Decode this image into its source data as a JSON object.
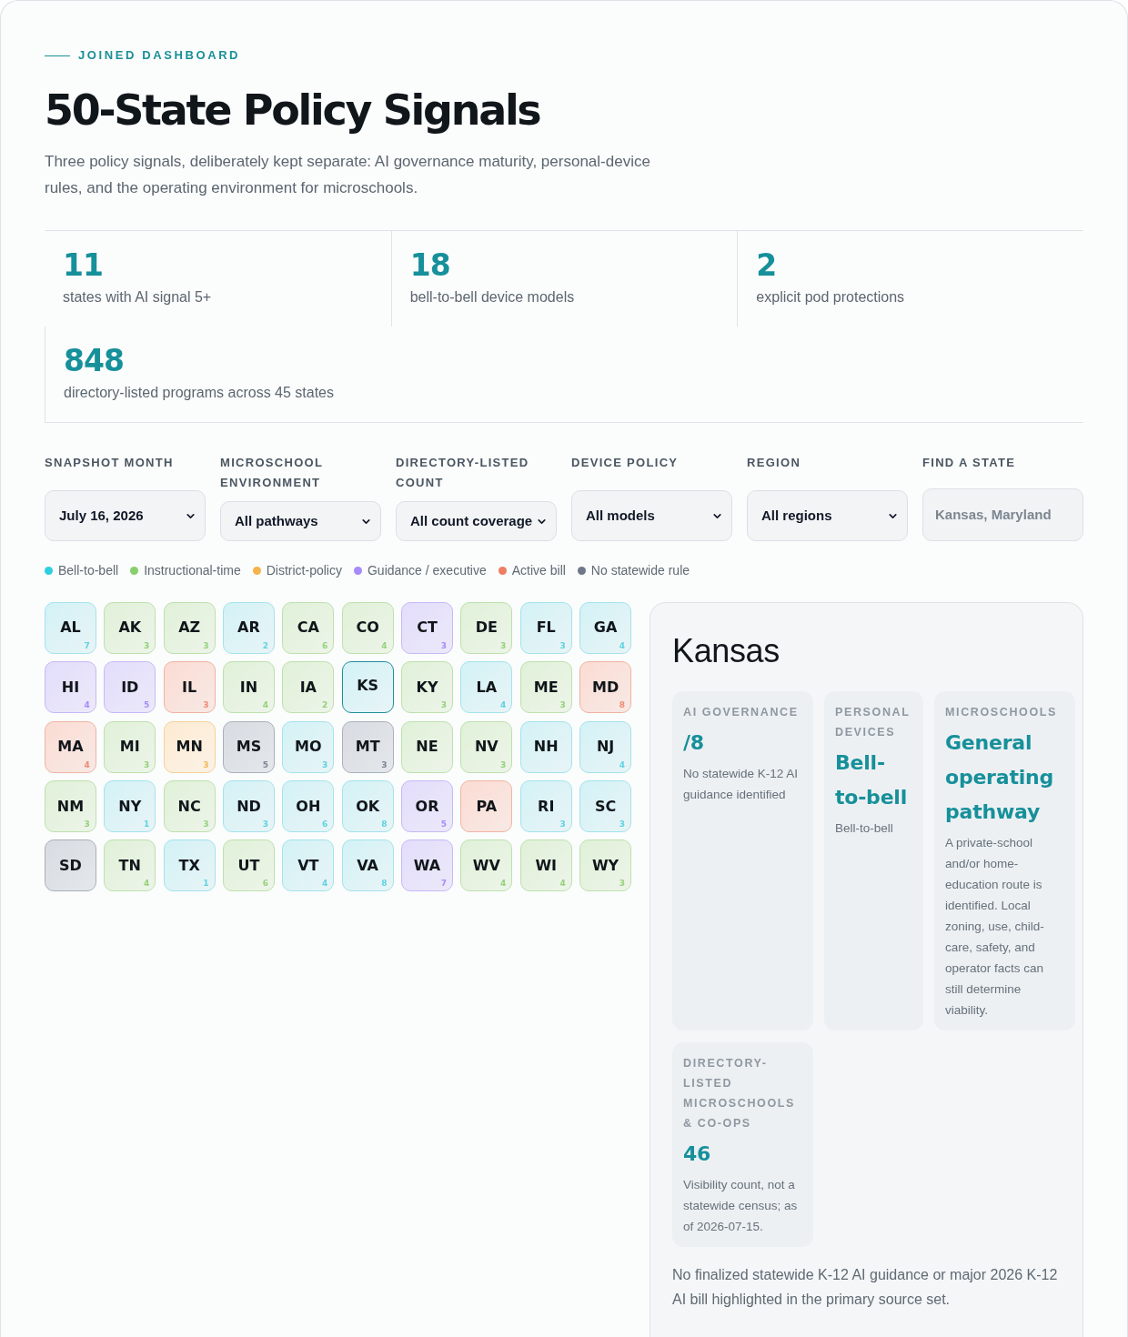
{
  "header": {
    "eyebrow": "JOINED DASHBOARD",
    "title": "50-State Policy Signals",
    "subtitle": "Three policy signals, deliberately kept separate: AI governance maturity, personal-device rules, and the operating environment for microschools."
  },
  "stats": [
    {
      "value": "11",
      "label": "states with AI signal 5+"
    },
    {
      "value": "18",
      "label": "bell-to-bell device models"
    },
    {
      "value": "2",
      "label": "explicit pod protections"
    },
    {
      "value": "848",
      "label": "directory-listed programs across 45 states"
    }
  ],
  "filters": [
    {
      "kind": "select",
      "label": "SNAPSHOT MONTH",
      "value": "July 16, 2026"
    },
    {
      "kind": "select",
      "label": "MICROSCHOOL ENVIRONMENT",
      "value": "All pathways"
    },
    {
      "kind": "select",
      "label": "DIRECTORY-LISTED COUNT",
      "value": "All count coverage"
    },
    {
      "kind": "select",
      "label": "DEVICE POLICY",
      "value": "All models"
    },
    {
      "kind": "select",
      "label": "REGION",
      "value": "All regions"
    },
    {
      "kind": "search",
      "label": "FIND A STATE",
      "placeholder": "Kansas, Maryland"
    }
  ],
  "legend": [
    {
      "label": "Bell-to-bell",
      "color": "#2ccfe0"
    },
    {
      "label": "Instructional-time",
      "color": "#86cf6a"
    },
    {
      "label": "District-policy",
      "color": "#f4b34c"
    },
    {
      "label": "Guidance / executive",
      "color": "#a78bfa"
    },
    {
      "label": "Active bill",
      "color": "#ee7d62"
    },
    {
      "label": "No statewide rule",
      "color": "#6f7889"
    }
  ],
  "states": [
    {
      "code": "AL",
      "count": "7",
      "kind": "bell",
      "selected": false
    },
    {
      "code": "AK",
      "count": "3",
      "kind": "instructional",
      "selected": false
    },
    {
      "code": "AZ",
      "count": "3",
      "kind": "instructional",
      "selected": false
    },
    {
      "code": "AR",
      "count": "2",
      "kind": "bell",
      "selected": false
    },
    {
      "code": "CA",
      "count": "6",
      "kind": "instructional",
      "selected": false
    },
    {
      "code": "CO",
      "count": "4",
      "kind": "instructional",
      "selected": false
    },
    {
      "code": "CT",
      "count": "3",
      "kind": "guidance",
      "selected": false
    },
    {
      "code": "DE",
      "count": "3",
      "kind": "instructional",
      "selected": false
    },
    {
      "code": "FL",
      "count": "3",
      "kind": "bell",
      "selected": false
    },
    {
      "code": "GA",
      "count": "4",
      "kind": "bell",
      "selected": false
    },
    {
      "code": "HI",
      "count": "4",
      "kind": "guidance",
      "selected": false
    },
    {
      "code": "ID",
      "count": "5",
      "kind": "guidance",
      "selected": false
    },
    {
      "code": "IL",
      "count": "3",
      "kind": "bill",
      "selected": false
    },
    {
      "code": "IN",
      "count": "4",
      "kind": "instructional",
      "selected": false
    },
    {
      "code": "IA",
      "count": "2",
      "kind": "instructional",
      "selected": false
    },
    {
      "code": "KS",
      "kind": "bell",
      "selected": true
    },
    {
      "code": "KY",
      "count": "3",
      "kind": "instructional",
      "selected": false
    },
    {
      "code": "LA",
      "count": "4",
      "kind": "bell",
      "selected": false
    },
    {
      "code": "ME",
      "count": "3",
      "kind": "instructional",
      "selected": false
    },
    {
      "code": "MD",
      "count": "8",
      "kind": "bill",
      "selected": false
    },
    {
      "code": "MA",
      "count": "4",
      "kind": "bill",
      "selected": false
    },
    {
      "code": "MI",
      "count": "3",
      "kind": "instructional",
      "selected": false
    },
    {
      "code": "MN",
      "count": "3",
      "kind": "district",
      "selected": false
    },
    {
      "code": "MS",
      "count": "5",
      "kind": "none",
      "selected": false
    },
    {
      "code": "MO",
      "count": "3",
      "kind": "bell",
      "selected": false
    },
    {
      "code": "MT",
      "count": "3",
      "kind": "none",
      "selected": false
    },
    {
      "code": "NE",
      "kind": "instructional",
      "selected": false
    },
    {
      "code": "NV",
      "count": "3",
      "kind": "instructional",
      "selected": false
    },
    {
      "code": "NH",
      "kind": "bell",
      "selected": false
    },
    {
      "code": "NJ",
      "count": "4",
      "kind": "bell",
      "selected": false
    },
    {
      "code": "NM",
      "count": "3",
      "kind": "instructional",
      "selected": false
    },
    {
      "code": "NY",
      "count": "1",
      "kind": "bell",
      "selected": false
    },
    {
      "code": "NC",
      "count": "3",
      "kind": "instructional",
      "selected": false
    },
    {
      "code": "ND",
      "count": "3",
      "kind": "bell",
      "selected": false
    },
    {
      "code": "OH",
      "count": "6",
      "kind": "bell",
      "selected": false
    },
    {
      "code": "OK",
      "count": "8",
      "kind": "bell",
      "selected": false
    },
    {
      "code": "OR",
      "count": "5",
      "kind": "guidance",
      "selected": false
    },
    {
      "code": "PA",
      "kind": "bill",
      "selected": false
    },
    {
      "code": "RI",
      "count": "3",
      "kind": "bell",
      "selected": false
    },
    {
      "code": "SC",
      "count": "3",
      "kind": "bell",
      "selected": false
    },
    {
      "code": "SD",
      "kind": "none",
      "selected": false
    },
    {
      "code": "TN",
      "count": "4",
      "kind": "instructional",
      "selected": false
    },
    {
      "code": "TX",
      "count": "1",
      "kind": "bell",
      "selected": false
    },
    {
      "code": "UT",
      "count": "6",
      "kind": "instructional",
      "selected": false
    },
    {
      "code": "VT",
      "count": "4",
      "kind": "bell",
      "selected": false
    },
    {
      "code": "VA",
      "count": "8",
      "kind": "bell",
      "selected": false
    },
    {
      "code": "WA",
      "count": "7",
      "kind": "guidance",
      "selected": false
    },
    {
      "code": "WV",
      "count": "4",
      "kind": "instructional",
      "selected": false
    },
    {
      "code": "WI",
      "count": "4",
      "kind": "instructional",
      "selected": false
    },
    {
      "code": "WY",
      "count": "3",
      "kind": "instructional",
      "selected": false
    }
  ],
  "detail": {
    "title": "Kansas",
    "cards": [
      {
        "label": "AI GOVERNANCE",
        "value": "/8",
        "note": "No statewide K-12 AI guidance identified"
      },
      {
        "label": "PERSONAL DEVICES",
        "value": "Bell-to-bell",
        "note": "Bell-to-bell"
      },
      {
        "label": "MICROSCHOOLS",
        "value": "General operating pathway",
        "note": "A private-school and/or home-education route is identified. Local zoning, use, child-care, safety, and operator facts can still determine viability."
      },
      {
        "label": "DIRECTORY-LISTED MICROSCHOOLS & CO-OPS",
        "value": "46",
        "note": "Visibility count, not a statewide census; as of 2026-07-15."
      }
    ],
    "summary": "No finalized statewide K-12 AI guidance or major 2026 K-12 AI bill highlighted in the primary source set."
  }
}
